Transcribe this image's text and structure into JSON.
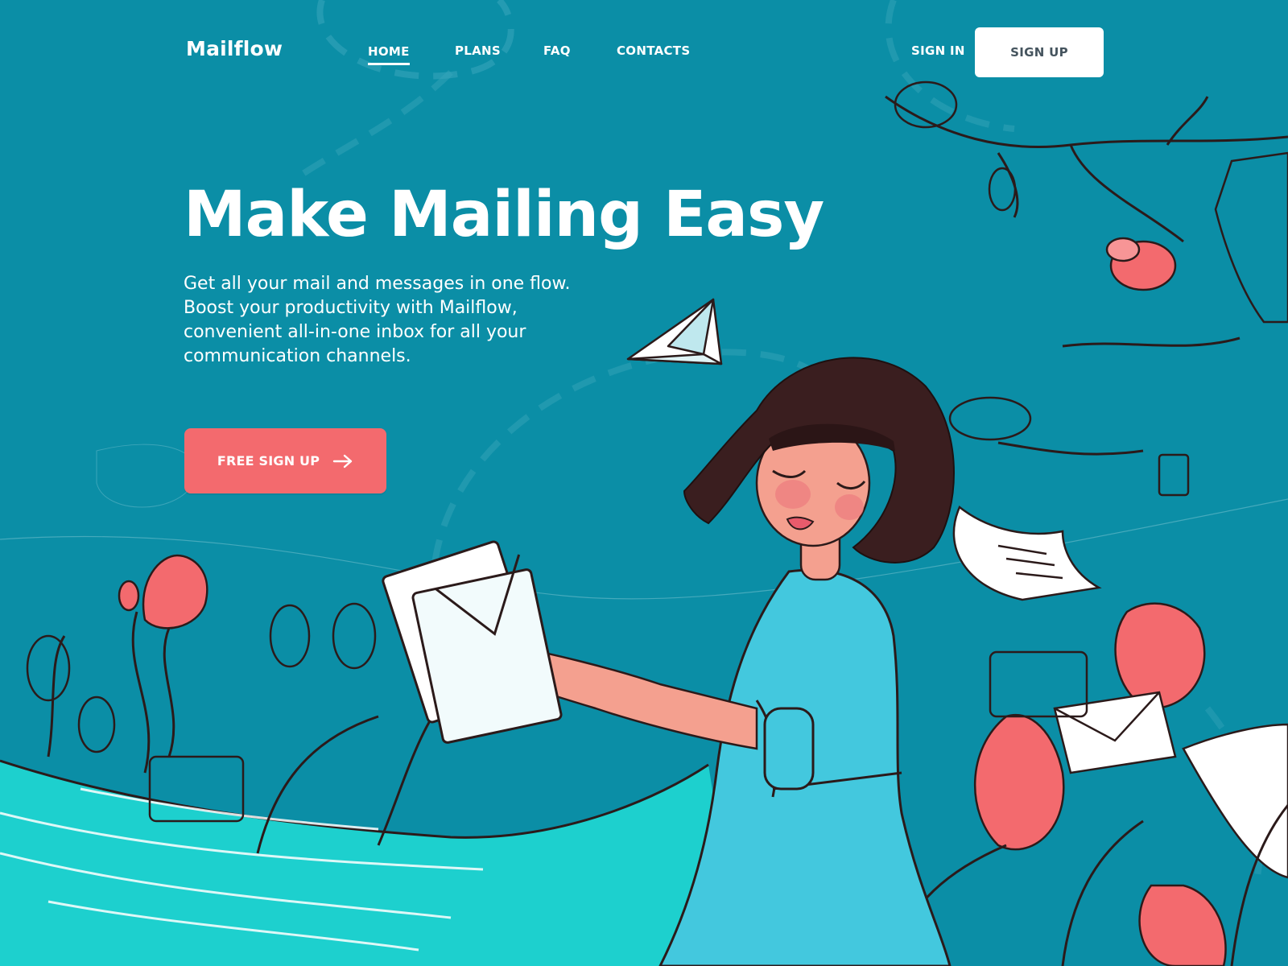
{
  "brand": {
    "name": "Mailflow"
  },
  "nav": {
    "items": [
      {
        "label": "HOME",
        "active": true
      },
      {
        "label": "PLANS",
        "active": false
      },
      {
        "label": "FAQ",
        "active": false
      },
      {
        "label": "CONTACTS",
        "active": false
      }
    ],
    "signin_label": "SIGN IN",
    "signup_label": "SIGN UP"
  },
  "hero": {
    "title": "Make Mailing Easy",
    "subtitle": "Get all your mail and messages in one flow. Boost your productivity with Mailflow, convenient all-in-one inbox for all your communication channels.",
    "cta_label": "FREE SIGN UP"
  },
  "colors": {
    "background": "#0b8ea6",
    "accent": "#f36a6e",
    "text": "#ffffff",
    "button_text": "#45545e"
  },
  "icons": {
    "cta_icon": "arrow-right-icon"
  }
}
